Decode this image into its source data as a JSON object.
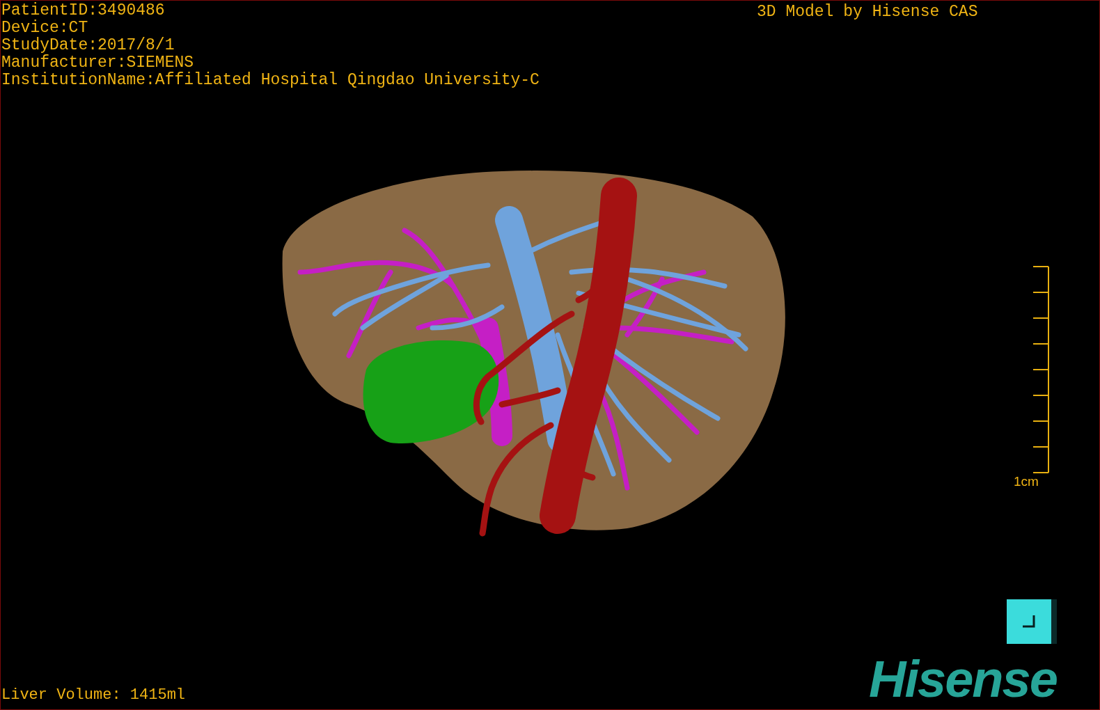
{
  "patient_info": [
    "PatientID:3490486",
    "Device:CT",
    "StudyDate:2017/8/1",
    "Manufacturer:SIEMENS",
    "InstitutionName:Affiliated Hospital Qingdao University-C"
  ],
  "header": "3D Model by Hisense CAS",
  "scale_bar": {
    "label": "1cm"
  },
  "logo": "Hisense",
  "liver_volume": "Liver Volume: 1415ml"
}
